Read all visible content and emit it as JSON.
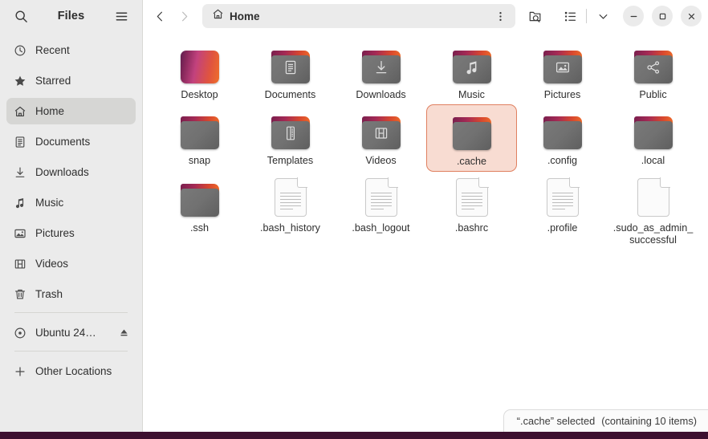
{
  "window": {
    "app_title": "Files",
    "desktop_bg_color": "#3d1030",
    "selection_bg_color": "#f8dcd2",
    "selection_border_color": "#e08060"
  },
  "sidebar": {
    "search_icon": "search-icon",
    "menu_icon": "hamburger-menu-icon",
    "items": [
      {
        "label": "Recent",
        "icon": "clock-icon",
        "selected": false
      },
      {
        "label": "Starred",
        "icon": "star-icon",
        "selected": false
      },
      {
        "label": "Home",
        "icon": "home-icon",
        "selected": true
      },
      {
        "label": "Documents",
        "icon": "document-icon",
        "selected": false
      },
      {
        "label": "Downloads",
        "icon": "download-icon",
        "selected": false
      },
      {
        "label": "Music",
        "icon": "music-note-icon",
        "selected": false
      },
      {
        "label": "Pictures",
        "icon": "image-icon",
        "selected": false
      },
      {
        "label": "Videos",
        "icon": "film-icon",
        "selected": false
      },
      {
        "label": "Trash",
        "icon": "trash-icon",
        "selected": false
      }
    ],
    "devices": [
      {
        "label": "Ubuntu 24…",
        "icon": "disc-icon",
        "eject_icon": "eject-icon"
      }
    ],
    "other_locations": {
      "label": "Other Locations",
      "icon": "plus-icon"
    }
  },
  "header": {
    "back_icon": "chevron-left-icon",
    "forward_icon": "chevron-right-icon",
    "path": {
      "label": "Home",
      "icon": "home-icon",
      "menu_icon": "vertical-dots-icon"
    },
    "search_folder_icon": "folder-search-icon",
    "view_list_icon": "list-view-icon",
    "view_dropdown_icon": "chevron-down-icon",
    "minimize_icon": "minimize-icon",
    "maximize_icon": "maximize-icon",
    "close_icon": "close-icon"
  },
  "files": [
    {
      "name": "Desktop",
      "type": "desktop-folder",
      "emblem": "none",
      "selected": false
    },
    {
      "name": "Documents",
      "type": "folder",
      "emblem": "document",
      "selected": false
    },
    {
      "name": "Downloads",
      "type": "folder",
      "emblem": "download",
      "selected": false
    },
    {
      "name": "Music",
      "type": "folder",
      "emblem": "music",
      "selected": false
    },
    {
      "name": "Pictures",
      "type": "folder",
      "emblem": "image",
      "selected": false
    },
    {
      "name": "Public",
      "type": "folder",
      "emblem": "share",
      "selected": false
    },
    {
      "name": "snap",
      "type": "folder",
      "emblem": "none",
      "selected": false
    },
    {
      "name": "Templates",
      "type": "folder",
      "emblem": "template",
      "selected": false
    },
    {
      "name": "Videos",
      "type": "folder",
      "emblem": "film",
      "selected": false
    },
    {
      "name": ".cache",
      "type": "folder",
      "emblem": "none",
      "selected": true
    },
    {
      "name": ".config",
      "type": "folder",
      "emblem": "none",
      "selected": false
    },
    {
      "name": ".local",
      "type": "folder",
      "emblem": "none",
      "selected": false
    },
    {
      "name": ".ssh",
      "type": "folder",
      "emblem": "none",
      "selected": false
    },
    {
      "name": ".bash_history",
      "type": "text-file",
      "emblem": "lines",
      "selected": false
    },
    {
      "name": ".bash_logout",
      "type": "text-file",
      "emblem": "lines",
      "selected": false
    },
    {
      "name": ".bashrc",
      "type": "text-file",
      "emblem": "lines",
      "selected": false
    },
    {
      "name": ".profile",
      "type": "text-file",
      "emblem": "lines",
      "selected": false
    },
    {
      "name": ".sudo_as_admin_successful",
      "type": "text-file",
      "emblem": "empty",
      "selected": false
    }
  ],
  "statusbar": {
    "text": "“.cache” selected",
    "detail": "(containing 10 items)"
  }
}
